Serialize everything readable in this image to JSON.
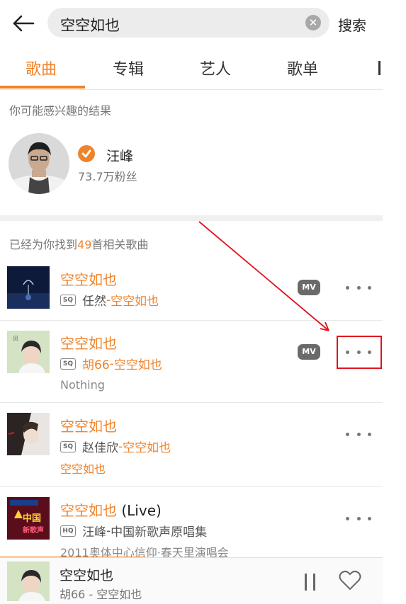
{
  "search": {
    "query": "空空如也",
    "submit_label": "搜索"
  },
  "tabs": [
    {
      "label": "歌曲"
    },
    {
      "label": "专辑"
    },
    {
      "label": "艺人"
    },
    {
      "label": "歌单"
    }
  ],
  "suggest": {
    "heading": "你可能感兴趣的结果",
    "artist_name": "汪峰",
    "artist_fans": "73.7万粉丝"
  },
  "results": {
    "prefix": "已经为你找到",
    "count": "49",
    "suffix": "首相关歌曲"
  },
  "songs": [
    {
      "title": "空空如也",
      "title_suffix": "",
      "quality": "SQ",
      "artist": "任然",
      "sep": " - ",
      "album": "空空如也",
      "extra": "",
      "mv": "MV"
    },
    {
      "title": "空空如也",
      "title_suffix": "",
      "quality": "SQ",
      "artist": "胡66",
      "sep": " - ",
      "album": "空空如也",
      "extra": "Nothing",
      "mv": "MV"
    },
    {
      "title": "空空如也",
      "title_suffix": "",
      "quality": "SQ",
      "artist": "赵佳欣",
      "sep": " - ",
      "album": "空空如也",
      "extra": "空空如也",
      "mv": ""
    },
    {
      "title": "空空如也",
      "title_suffix": " (Live)",
      "quality": "HQ",
      "artist": "汪峰",
      "sep": " - ",
      "album": "中国新歌声原唱集",
      "extra": "2011奥体中心信仰·春天里演唱会",
      "mv": ""
    }
  ],
  "player": {
    "title": "空空如也",
    "subtitle": "胡66 - 空空如也",
    "progress": 0.38
  },
  "colors": {
    "accent": "#f0832a",
    "annotation": "#e0141e"
  }
}
